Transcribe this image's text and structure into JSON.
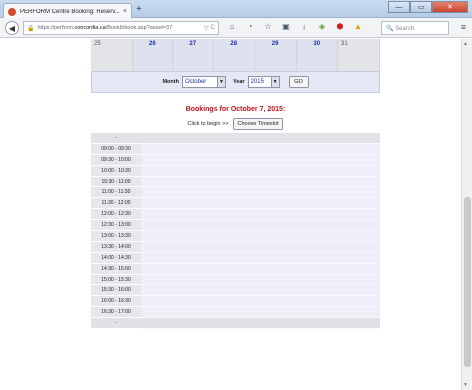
{
  "browser": {
    "tab_title": "PERFORM Centre Booking: Reserv...",
    "tab_close": "×",
    "new_tab": "+",
    "url_prefix": "https://perform.",
    "url_domain": "concordia.ca",
    "url_path": "/BookIt/book.asp?asset=37",
    "search_placeholder": "Search",
    "icons": [
      "back-icon",
      "lock-icon",
      "reload-icon",
      "home-icon",
      "rss-icon",
      "star-icon",
      "clipboard-icon",
      "download-icon",
      "addon-icon",
      "abp-icon",
      "warning-icon",
      "menu-icon"
    ]
  },
  "calendar": {
    "days": [
      "25",
      "26",
      "27",
      "28",
      "29",
      "30",
      "31"
    ]
  },
  "controls": {
    "month_label": "Month",
    "month_value": "October",
    "year_label": "Year",
    "year_value": "2015",
    "go_label": "GO"
  },
  "bookings": {
    "heading": "Bookings for October 7, 2015:",
    "begin_text": "Click to begin >>",
    "timeslot_button": "Choose Timeslot",
    "header_cell": "-",
    "footer_cell": "-",
    "slots": [
      "09:00 - 09:30",
      "09:30 - 10:00",
      "10:00 - 10:30",
      "10:30 - 11:00",
      "11:00 - 11:30",
      "11:30 - 12:00",
      "12:00 - 12:30",
      "12:30 - 13:00",
      "13:00 - 13:30",
      "13:30 - 14:00",
      "14:00 - 14:30",
      "14:30 - 15:00",
      "15:00 - 15:30",
      "15:30 - 16:00",
      "16:00 - 16:30",
      "16:30 - 17:00"
    ]
  },
  "colors": {
    "heading_red": "#c1121b",
    "date_blue": "#1a2fae",
    "slot_bg": "#edeef8"
  }
}
